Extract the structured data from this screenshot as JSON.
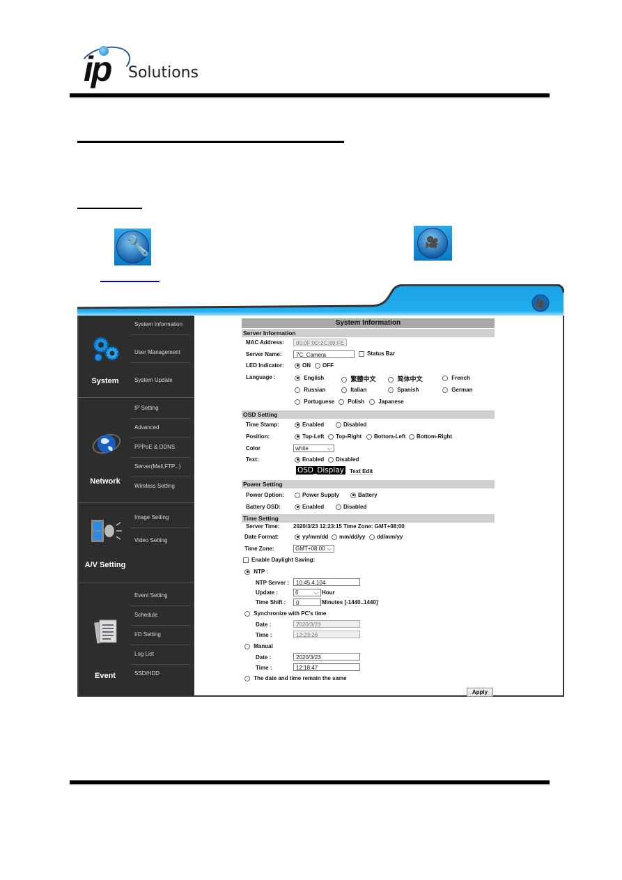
{
  "brand": {
    "logo_mark": "ip",
    "logo_text": "Solutions"
  },
  "icons": {
    "wrench": "wrench-icon",
    "camera": "camera-icon"
  },
  "ui": {
    "sidebar": {
      "groups": [
        {
          "title": "System",
          "icon": "gears-icon",
          "items": [
            "System Information",
            "User Management",
            "System Update"
          ]
        },
        {
          "title": "Network",
          "icon": "globe-icon",
          "items": [
            "IP Setting",
            "Advanced",
            "PPPoE & DDNS",
            "Server(Mail,FTP...)",
            "Wireless Setting"
          ]
        },
        {
          "title": "A/V Setting",
          "icon": "film-speaker-icon",
          "items": [
            "Image Setting",
            "Video Setting"
          ]
        },
        {
          "title": "Event",
          "icon": "documents-icon",
          "items": [
            "Event Setting",
            "Schedule",
            "I/O Setting",
            "Log List",
            "SSD/HDD"
          ]
        }
      ]
    },
    "page_title": "System Information",
    "server_info": {
      "section": "Server Information",
      "mac_label": "MAC Address:",
      "mac_value": "00:0F:0D:2C:89:FE",
      "name_label": "Server Name:",
      "name_value": "7C_Camera",
      "status_bar_label": "Status Bar",
      "status_bar_checked": false,
      "led_label": "LED Indicator:",
      "led_options": [
        "ON",
        "OFF"
      ],
      "led_selected": "ON",
      "language_label": "Language :",
      "languages": [
        "English",
        "繁體中文",
        "简体中文",
        "French",
        "Russian",
        "Italian",
        "Spanish",
        "German",
        "Portuguese",
        "Polish",
        "Japanese"
      ],
      "language_selected": "English"
    },
    "osd": {
      "section": "OSD Setting",
      "timestamp_label": "Time Stamp:",
      "timestamp_options": [
        "Enabled",
        "Disabled"
      ],
      "timestamp_selected": "Enabled",
      "position_label": "Position:",
      "position_options": [
        "Top-Left",
        "Top-Right",
        "Bottom-Left",
        "Bottom-Right"
      ],
      "position_selected": "Top-Left",
      "color_label": "Color",
      "color_value": "white",
      "text_label": "Text:",
      "text_options": [
        "Enabled",
        "Disabled"
      ],
      "text_selected": "Enabled",
      "display_text": "OSD_Display",
      "text_edit": "Text Edit"
    },
    "power": {
      "section": "Power Setting",
      "option_label": "Power Option:",
      "options": [
        "Power Supply",
        "Battery"
      ],
      "selected": "Battery",
      "battery_osd_label": "Battery OSD:",
      "battery_osd_options": [
        "Enabled",
        "Disabled"
      ],
      "battery_osd_selected": "Enabled"
    },
    "time": {
      "section": "Time Setting",
      "server_time_label": "Server Time:",
      "server_time_value": "2020/3/23 12:23:15 Time Zone: GMT+08:00",
      "date_format_label": "Date Format:",
      "date_formats": [
        "yy/mm/dd",
        "mm/dd/yy",
        "dd/mm/yy"
      ],
      "date_format_selected": "yy/mm/dd",
      "timezone_label": "Time Zone:",
      "timezone_value": "GMT+08:00",
      "dst_label": "Enable Daylight Saving:",
      "dst_checked": false,
      "ntp_label": "NTP :",
      "ntp_selected": true,
      "ntp_server_label": "NTP Server :",
      "ntp_server_value": "10.45.4.104",
      "update_label": "Update :",
      "update_value": "6",
      "update_unit": "Hour",
      "shift_label": "Time Shift :",
      "shift_value": "0",
      "shift_unit": "Minutes  [-1440..1440]",
      "sync_pc_label": "Synchronize with PC's time",
      "sync_date_label": "Date :",
      "sync_date_value": "2020/3/23",
      "sync_time_label": "Time :",
      "sync_time_value": "12:23:26",
      "manual_label": "Manual",
      "manual_date_label": "Date :",
      "manual_date_value": "2020/3/23",
      "manual_time_label": "Time :",
      "manual_time_value": "12:18:47",
      "remain_label": "The date and time remain the same"
    },
    "apply_label": "Apply"
  }
}
